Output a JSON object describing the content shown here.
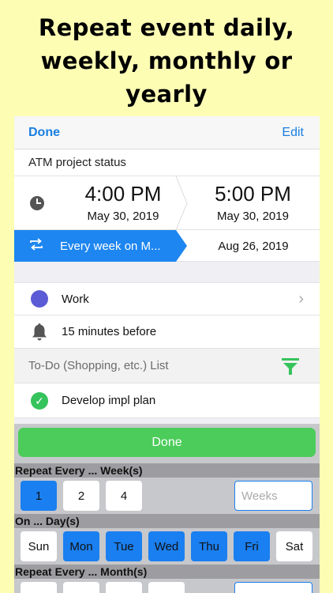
{
  "headline": [
    "Repeat event daily,",
    "weekly, monthly or",
    "yearly"
  ],
  "nav": {
    "done": "Done",
    "edit": "Edit"
  },
  "event": {
    "title": "ATM project status",
    "start_time": "4:00 PM",
    "start_date": "May 30, 2019",
    "end_time": "5:00 PM",
    "end_date": "May 30, 2019",
    "repeat": "Every week on M...",
    "repeat_end": "Aug 26, 2019"
  },
  "calendar": {
    "label": "Work",
    "color": "#5b5bd6"
  },
  "alert": {
    "label": "15 minutes before"
  },
  "todo": {
    "header": "To-Do (Shopping, etc.) List",
    "item": "Develop impl plan"
  },
  "picker": {
    "done": "Done",
    "weeks_header": "Repeat Every ... Week(s)",
    "weeks_options": [
      "1",
      "2",
      "4"
    ],
    "weeks_selected": "1",
    "weeks_placeholder": "Weeks",
    "days_header": "On ... Day(s)",
    "days": [
      "Sun",
      "Mon",
      "Tue",
      "Wed",
      "Thu",
      "Fri",
      "Sat"
    ],
    "days_selected": [
      "Mon",
      "Tue",
      "Wed",
      "Thu",
      "Fri"
    ],
    "months_header": "Repeat Every ... Month(s)"
  },
  "colors": {
    "accent": "#1a7fe0",
    "done_green": "#4ccc5a",
    "background": "#fdfdb4"
  }
}
